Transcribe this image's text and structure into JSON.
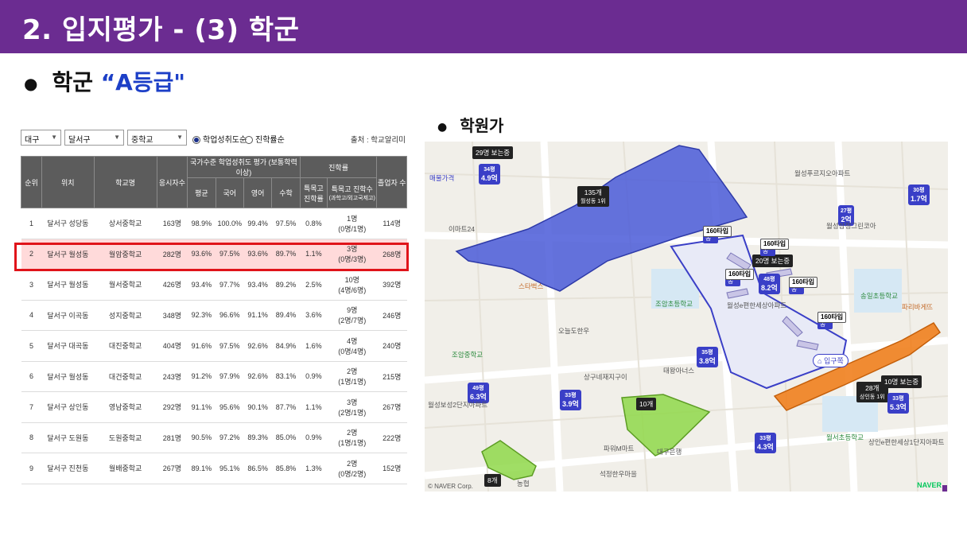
{
  "slide": {
    "title": "2. 입지평가 - (3) 학군",
    "bullet_main_prefix": "학군",
    "bullet_main_grade": "“A등급\"",
    "bullet_sub": "학원가"
  },
  "table_panel": {
    "filters": {
      "region": "대구",
      "district": "달서구",
      "school_type": "중학교"
    },
    "radio_options": [
      {
        "label": "학업성취도순",
        "selected": true
      },
      {
        "label": "진학률순",
        "selected": false
      }
    ],
    "source": "출처 : 학교알리미",
    "headers": {
      "rank": "순위",
      "location": "위치",
      "school": "학교명",
      "test_takers": "응시자수",
      "group_achievement": "국가수준 학업성취도 평가 (보통학력이상)",
      "avg": "평균",
      "korean": "국어",
      "english": "영어",
      "math": "수학",
      "group_advance": "진학률",
      "special_rate": "특목고 진학률",
      "special_count": "특목고 진학수",
      "special_count_sub": "(과학고/외고국제고)",
      "graduates": "졸업자 수"
    },
    "rows": [
      {
        "rank": "1",
        "location": "달서구 성당동",
        "school": "상서중학교",
        "takers": "163명",
        "avg": "98.9%",
        "korean": "100.0%",
        "english": "99.4%",
        "math": "97.5%",
        "rate": "0.8%",
        "count": "1명",
        "count_sub": "(0명/1명)",
        "grads": "114명"
      },
      {
        "rank": "2",
        "location": "달서구 월성동",
        "school": "월암중학교",
        "takers": "282명",
        "avg": "93.6%",
        "korean": "97.5%",
        "english": "93.6%",
        "math": "89.7%",
        "rate": "1.1%",
        "count": "3명",
        "count_sub": "(0명/3명)",
        "grads": "268명"
      },
      {
        "rank": "3",
        "location": "달서구 월성동",
        "school": "월서중학교",
        "takers": "426명",
        "avg": "93.4%",
        "korean": "97.7%",
        "english": "93.4%",
        "math": "89.2%",
        "rate": "2.5%",
        "count": "10명",
        "count_sub": "(4명/6명)",
        "grads": "392명"
      },
      {
        "rank": "4",
        "location": "달서구 이곡동",
        "school": "성지중학교",
        "takers": "348명",
        "avg": "92.3%",
        "korean": "96.6%",
        "english": "91.1%",
        "math": "89.4%",
        "rate": "3.6%",
        "count": "9명",
        "count_sub": "(2명/7명)",
        "grads": "246명"
      },
      {
        "rank": "5",
        "location": "달서구 대곡동",
        "school": "대진중학교",
        "takers": "404명",
        "avg": "91.6%",
        "korean": "97.5%",
        "english": "92.6%",
        "math": "84.9%",
        "rate": "1.6%",
        "count": "4명",
        "count_sub": "(0명/4명)",
        "grads": "240명"
      },
      {
        "rank": "6",
        "location": "달서구 월성동",
        "school": "대건중학교",
        "takers": "243명",
        "avg": "91.2%",
        "korean": "97.9%",
        "english": "92.6%",
        "math": "83.1%",
        "rate": "0.9%",
        "count": "2명",
        "count_sub": "(1명/1명)",
        "grads": "215명"
      },
      {
        "rank": "7",
        "location": "달서구 상인동",
        "school": "영남중학교",
        "takers": "292명",
        "avg": "91.1%",
        "korean": "95.6%",
        "english": "90.1%",
        "math": "87.7%",
        "rate": "1.1%",
        "count": "3명",
        "count_sub": "(2명/1명)",
        "grads": "267명"
      },
      {
        "rank": "8",
        "location": "달서구 도원동",
        "school": "도원중학교",
        "takers": "281명",
        "avg": "90.5%",
        "korean": "97.2%",
        "english": "89.3%",
        "math": "85.0%",
        "rate": "0.9%",
        "count": "2명",
        "count_sub": "(1명/1명)",
        "grads": "222명"
      },
      {
        "rank": "9",
        "location": "달서구 진천동",
        "school": "월배중학교",
        "takers": "267명",
        "avg": "89.1%",
        "korean": "95.1%",
        "english": "86.5%",
        "math": "85.8%",
        "rate": "1.3%",
        "count": "2명",
        "count_sub": "(0명/2명)",
        "grads": "152명"
      }
    ]
  },
  "map": {
    "colors": {
      "blue_zone": "#4a5ad8",
      "orange_zone": "#f07f1e",
      "green_zone": "#8fd84a",
      "pin": "#3a3fc7"
    },
    "tags": {
      "main_top": "29명 보는중",
      "blue_count": "135개",
      "blue_sub": "월성동 1위",
      "green_center": "10개",
      "green_left": "8개",
      "orange_count": "28개",
      "orange_sub": "상인동 1위",
      "orange_watch": "10명 보는중",
      "apt_watch": "20명 보는중"
    },
    "pins": [
      {
        "top": "34평",
        "price": "4.9억"
      },
      {
        "top": "30평",
        "price": "1.7억"
      },
      {
        "top": "27평",
        "price": "2억"
      },
      {
        "top": "48평",
        "price": "8.2억"
      },
      {
        "top": "35평",
        "price": "3.8억"
      },
      {
        "top": "49평",
        "price": "6.3억"
      },
      {
        "top": "33평",
        "price": "3.9억"
      },
      {
        "top": "33평",
        "price": "5.3억"
      },
      {
        "top": "33평",
        "price": "4.3억"
      }
    ],
    "dongs": [
      {
        "dong": "104동",
        "type": "160타입"
      },
      {
        "dong": "106동",
        "type": "160타입"
      },
      {
        "dong": "103동",
        "type": "160타입"
      },
      {
        "dong": "107동",
        "type": "160타입"
      },
      {
        "dong": "108동",
        "type": "160타입"
      }
    ],
    "entrance": "입구쪽",
    "labels": {
      "schools": [
        "조암초등학교",
        "조암중학교",
        "월서초등학교",
        "송일초등학교"
      ],
      "apts": [
        "월성푸르지오아파트",
        "월성삼정그린코아",
        "월성e편한세상아파트",
        "상인e편한세상1단지아파트",
        "월성보성2단지아파트"
      ],
      "places": [
        "이마트24",
        "파리바게뜨",
        "스타벅스",
        "오늘도한우",
        "상구네재지구이",
        "파워M마트",
        "석정한우마을",
        "대구은행",
        "농협",
        "태왕아너스"
      ]
    },
    "real_estate": "매물가격",
    "copyright": "© NAVER Corp.",
    "logo": "NAVER"
  }
}
